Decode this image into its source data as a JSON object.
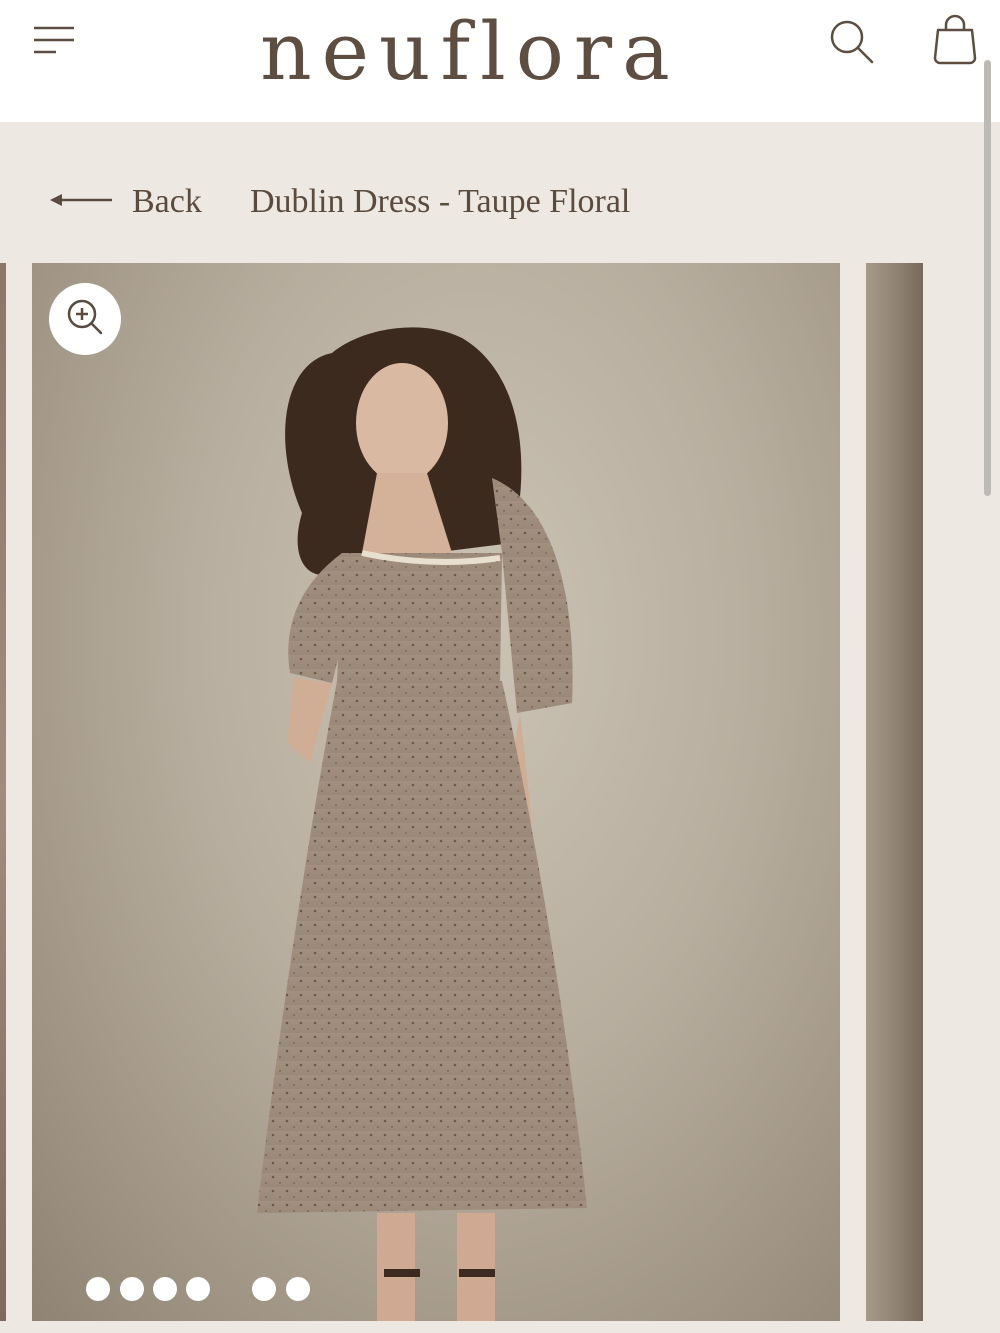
{
  "header": {
    "logo_text": "neuflora",
    "menu_icon": "hamburger-menu-icon",
    "search_icon": "search-icon",
    "bag_icon": "shopping-bag-icon"
  },
  "breadcrumb": {
    "back_label": "Back",
    "product_title": "Dublin Dress - Taupe Floral"
  },
  "gallery": {
    "zoom_icon": "zoom-in-icon",
    "pagination_dot_count": 6,
    "active_dot_index": 0
  },
  "colors": {
    "page_background": "#ede9e2",
    "header_background": "#ffffff",
    "text_brown": "#5b4a3e",
    "dress_taupe": "#a89787"
  }
}
